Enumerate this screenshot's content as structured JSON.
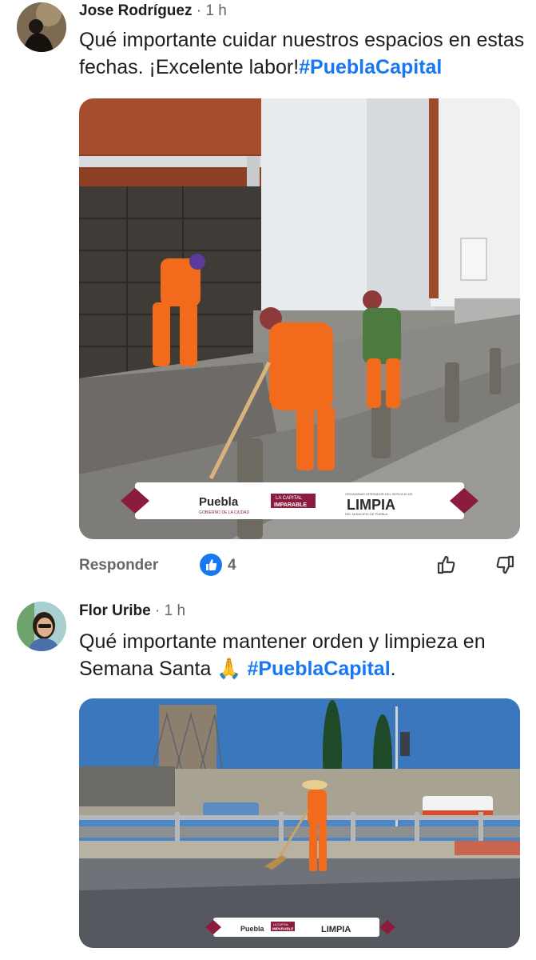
{
  "comments": [
    {
      "author": "Jose Rodríguez",
      "time": " · 1 h",
      "text": "Qué importante cuidar nuestros espacios en estas fechas. ¡Excelente labor!",
      "hashtag": "#PueblaCapital",
      "photo_logos": {
        "puebla": "Puebla",
        "puebla_sub": "GOBIERNO DE LA CIUDAD",
        "badge_line1": "LA CAPITAL",
        "badge_line2": "IMPARABLE",
        "limpia": "LIMPIA",
        "limpia_sub_top": "ORGANISMO OPERADOR DEL SERVICIO DE",
        "limpia_sub_bottom": "DEL MUNICIPIO DE PUEBLA"
      },
      "actions": {
        "reply_label": "Responder",
        "like_count": "4",
        "like_icon": "thumbs-up-icon",
        "dislike_icon": "thumbs-down-icon"
      }
    },
    {
      "author": "Flor Uribe",
      "time": " · 1 h",
      "text_before": "Qué importante mantener orden y limpieza en Semana Santa ",
      "emoji": "🙏",
      "hashtag": "#PueblaCapital",
      "text_after": ".",
      "photo_logos": {
        "puebla": "Puebla",
        "badge_line1": "LA CAPITAL",
        "badge_line2": "IMPARABLE",
        "limpia": "LIMPIA"
      }
    }
  ],
  "colors": {
    "link": "#1877f2",
    "muted": "#65676b",
    "text": "#1c1e21",
    "vest_orange": "#f26a1b",
    "brand_maroon": "#8b1c3d"
  }
}
